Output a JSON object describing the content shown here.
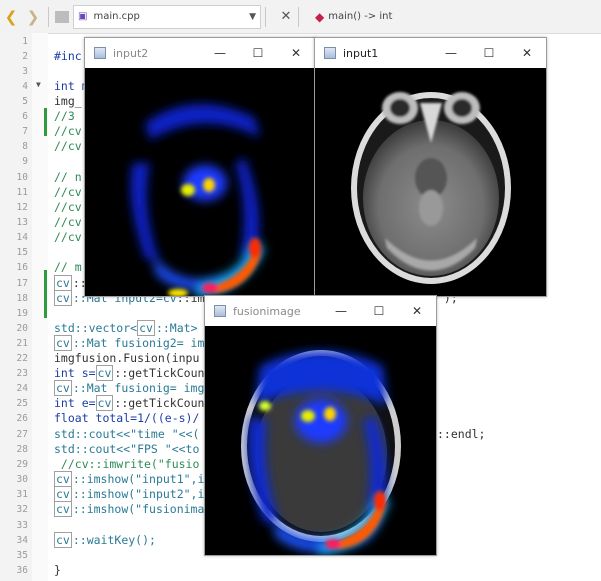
{
  "toolbar": {
    "back_icon": "back-arrow-icon",
    "forward_icon": "forward-arrow-icon",
    "file_name": "main.cpp",
    "scope": "main() -> int"
  },
  "editor": {
    "line_numbers": [
      "1",
      "2",
      "3",
      "4",
      "5",
      "6",
      "7",
      "8",
      "9",
      "10",
      "11",
      "12",
      "13",
      "14",
      "15",
      "16",
      "17",
      "18",
      "19",
      "20",
      "21",
      "22",
      "23",
      "24",
      "25",
      "26",
      "27",
      "28",
      "29",
      "30",
      "31",
      "32",
      "33",
      "34",
      "35",
      "36"
    ],
    "lines": {
      "l2": "#inc",
      "l4": "int m",
      "l5": "img_",
      "l6": "//3",
      "l7": "//cv",
      "l8": "//cv",
      "l10": "// n",
      "l11": "//cv",
      "l12": "//cv",
      "l13": "//cv",
      "l14": "//cv",
      "l16": "// m",
      "l17_ns": "cv",
      "l17": "::",
      "l18_ns": "cv",
      "l18a": "::Mat input2=",
      "l18b": "cv",
      "l18c": "::im",
      "l18d": "\");",
      "l21a": "std::vector<",
      "l21ns": "cv",
      "l21b": "::Mat>",
      "l22ns": "cv",
      "l22": "::Mat fusionig2= im",
      "l23": "imgfusion.Fusion(inpu",
      "l24a": "int s=",
      "l24ns": "cv",
      "l24b": "::getTickCoun",
      "l25ns": "cv",
      "l25": "::Mat fusionig= img",
      "l26a": "int e=",
      "l26ns": "cv",
      "l26b": "::getTickCoun",
      "l27": "float total=1/((e-s)/",
      "l28a": "std::cout<<\"time \"<<(",
      "l28b": "::endl;",
      "l29": "std::cout<<\"FPS \"<<to",
      "l30": " //cv::imwrite(\"fusio",
      "l31ns": "cv",
      "l31": "::imshow(\"input1\",i",
      "l32ns": "cv",
      "l32": "::imshow(\"input2\",i",
      "l33ns": "cv",
      "l33": "::imshow(\"fusionima",
      "l35ns": "cv",
      "l35": "::waitKey();",
      "l37": "}"
    }
  },
  "windows": {
    "input2": {
      "title": "input2",
      "active": false
    },
    "input1": {
      "title": "input1",
      "active": true
    },
    "fusion": {
      "title": "fusionimage",
      "active": false
    }
  },
  "window_buttons": {
    "minimize": "—",
    "maximize": "☐",
    "close": "✕"
  }
}
